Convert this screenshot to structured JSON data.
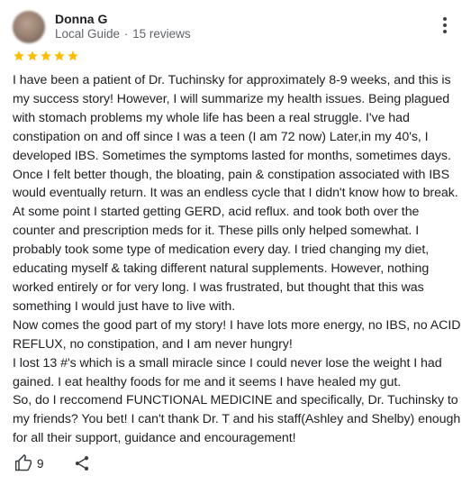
{
  "reviewer": {
    "name": "Donna G",
    "badge": "Local Guide",
    "separator": "·",
    "reviews_count": "15 reviews"
  },
  "rating": {
    "stars": 5,
    "max": 5,
    "color": "#fbbc04"
  },
  "review": {
    "paragraphs": [
      "I have been a patient of Dr. Tuchinsky for approximately 8-9 weeks, and this is my success story! However, I will summarize my health issues. Being plagued with stomach problems my whole life has been a real struggle. I've had constipation on and off since I was a teen (I am 72 now) Later,in my 40's, I developed IBS. Sometimes the symptoms lasted for months, sometimes days. Once I felt better though, the bloating, pain & constipation associated with IBS would eventually return. It was an endless cycle that I didn't know how to break. At some point I started getting GERD, acid reflux. and took both over the counter and prescription meds for it. These pills only helped somewhat. I probably took some type of medication every day. I tried changing my diet, educating myself & taking different natural supplements. However, nothing worked entirely or for very long. I was frustrated, but thought that this was something I would just have to live with.",
      "Now comes the good part of my story! I have lots more energy, no IBS, no ACID REFLUX, no constipation, and I am never hungry!",
      "I lost 13 #'s which is a small miracle since I could never lose the weight I had gained. I eat healthy foods for me and it seems I have healed my gut.",
      "So, do I reccomend FUNCTIONAL MEDICINE and specifically, Dr. Tuchinsky to my friends? You bet! I can't thank Dr. T and his staff(Ashley and Shelby) enough for all their support, guidance and encouragement!"
    ]
  },
  "actions": {
    "like_count": "9",
    "like_icon": "thumbs-up-icon",
    "share_icon": "share-icon",
    "more_icon": "more-vert-icon"
  }
}
